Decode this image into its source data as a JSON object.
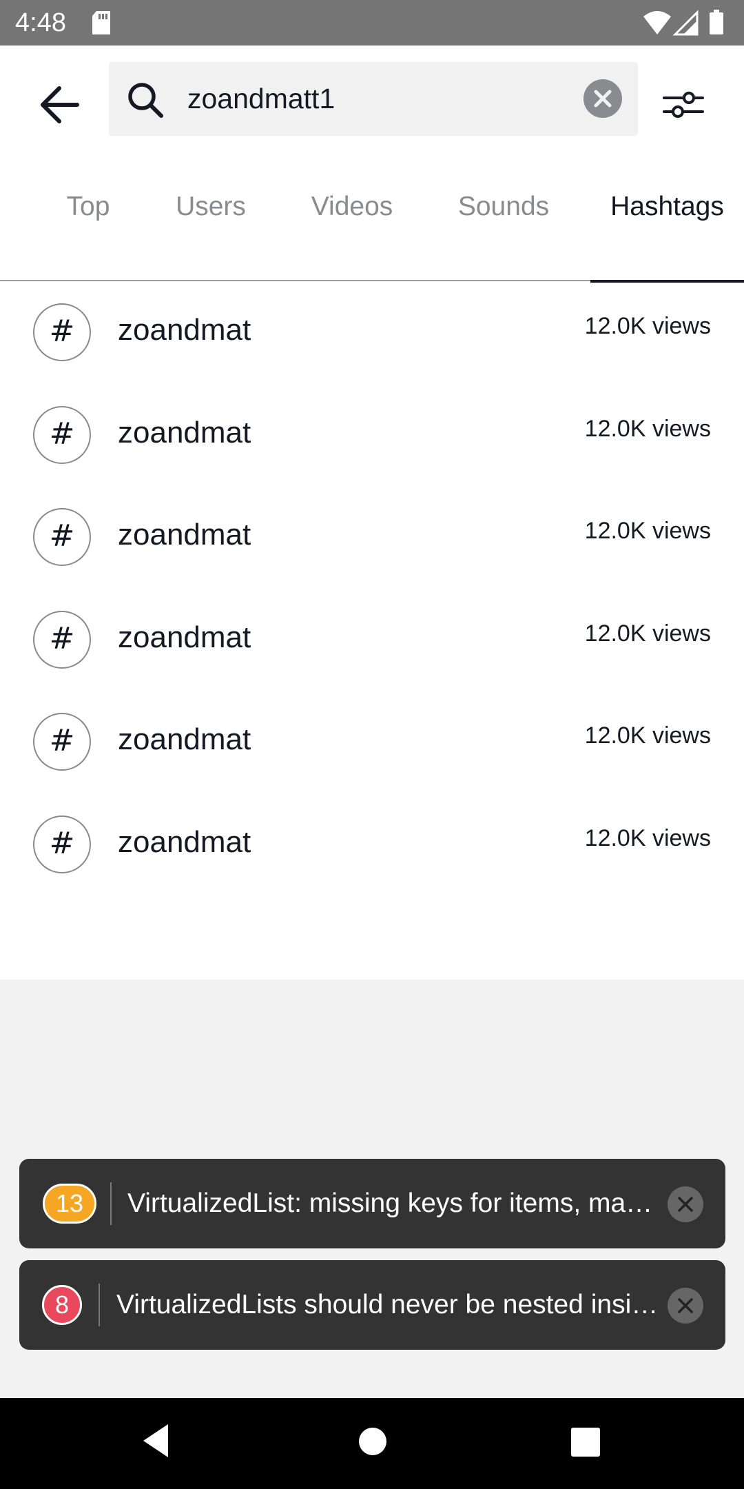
{
  "status_bar": {
    "time": "4:48",
    "icons": [
      "sd-card-icon",
      "wifi-icon",
      "signal-icon",
      "battery-icon"
    ]
  },
  "search": {
    "query": "zoandmatt1"
  },
  "tabs": [
    {
      "label": "Top",
      "active": false
    },
    {
      "label": "Users",
      "active": false
    },
    {
      "label": "Videos",
      "active": false
    },
    {
      "label": "Sounds",
      "active": false
    },
    {
      "label": "Hashtags",
      "active": true
    }
  ],
  "hashtags": [
    {
      "symbol": "#",
      "name": "zoandmat",
      "views": "12.0K views"
    },
    {
      "symbol": "#",
      "name": "zoandmat",
      "views": "12.0K views"
    },
    {
      "symbol": "#",
      "name": "zoandmat",
      "views": "12.0K views"
    },
    {
      "symbol": "#",
      "name": "zoandmat",
      "views": "12.0K views"
    },
    {
      "symbol": "#",
      "name": "zoandmat",
      "views": "12.0K views"
    },
    {
      "symbol": "#",
      "name": "zoandmat",
      "views": "12.0K views"
    }
  ],
  "toasts": [
    {
      "count": "13",
      "color": "#f5a623",
      "message": "VirtualizedList: missing keys for items, ma…"
    },
    {
      "count": "8",
      "color": "#e8495c",
      "message": "VirtualizedLists should never be nested insi…"
    }
  ],
  "colors": {
    "text_primary": "#161823",
    "text_secondary": "#8a8b91",
    "search_bg": "#f1f1f2",
    "toast_bg": "#333333"
  }
}
